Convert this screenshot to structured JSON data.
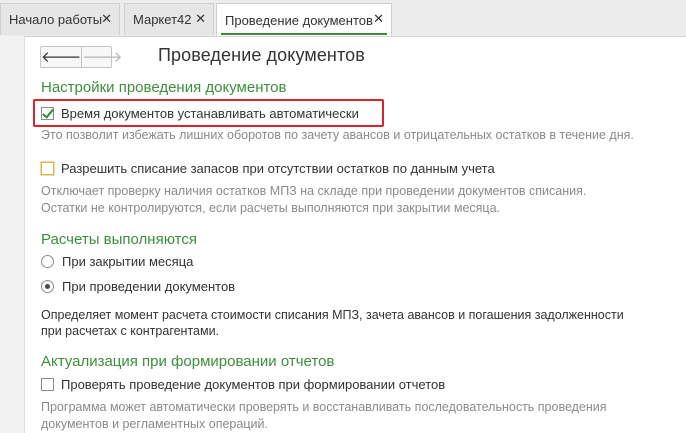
{
  "tabs": [
    {
      "label": "Начало работы",
      "close": "✕"
    },
    {
      "label": "Маркет42",
      "close": "✕"
    },
    {
      "label": "Проведение документов",
      "close": "✕",
      "active": true
    }
  ],
  "header": {
    "back_icon": "arrow-left-icon",
    "forward_icon": "arrow-right-icon",
    "back_glyph": "🡐",
    "forward_glyph": "🡒",
    "title": "Проведение документов"
  },
  "settings": {
    "title": "Настройки проведения документов",
    "auto_time": {
      "label": "Время документов устанавливать автоматически",
      "checked": true,
      "hint": "Это позволит избежать лишних оборотов по зачету авансов и отрицательных остатков в течение дня."
    },
    "allow_writeoff": {
      "label": "Разрешить списание запасов при отсутствии остатков по данным учета",
      "checked": false,
      "hint_line1": "Отключает проверку наличия остатков МПЗ на складе при проведении документов списания.",
      "hint_line2": "Остатки не контролируются, если расчеты выполняются при закрытии месяца."
    }
  },
  "calculations": {
    "title": "Расчеты выполняются",
    "options": [
      {
        "label": "При закрытии месяца",
        "selected": false
      },
      {
        "label": "При проведении документов",
        "selected": true
      }
    ],
    "hint_line1": "Определяет момент расчета стоимости списания МПЗ, зачета авансов и погашения задолженности",
    "hint_line2": "при расчетах с контрагентами."
  },
  "reports": {
    "title": "Актуализация при формировании отчетов",
    "check_posting": {
      "label": "Проверять проведение документов при формировании отчетов",
      "checked": false
    },
    "hint_line1": "Программа может автоматически проверять и восстанавливать последовательность проведения",
    "hint_line2": "документов и регламентных операций."
  },
  "colors": {
    "accent_green": "#3c8f3c",
    "highlight_red": "#d6252b",
    "hint_gray": "#8a8a8a"
  }
}
